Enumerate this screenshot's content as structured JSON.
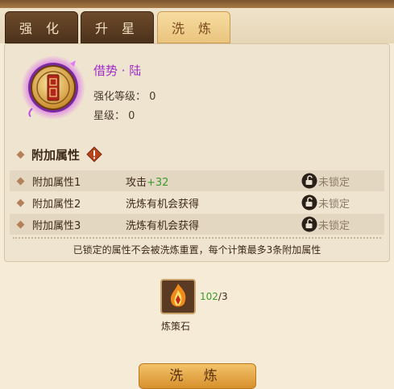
{
  "tabs": [
    {
      "label": "强 化",
      "active": false
    },
    {
      "label": "升 星",
      "active": false
    },
    {
      "label": "洗 炼",
      "active": true
    }
  ],
  "item": {
    "name": "借势 · 陆",
    "enhance_level": "强化等级：  0",
    "star_level": "星级：  0",
    "icon": "strategy-scroll-badge"
  },
  "attributes": {
    "title": "附加属性",
    "rows": [
      {
        "label": "附加属性1",
        "value_prefix": "攻击",
        "value_bonus": "+32",
        "lock_text": "未锁定"
      },
      {
        "label": "附加属性2",
        "value_prefix": "洗炼有机会获得",
        "value_bonus": "",
        "lock_text": "未锁定"
      },
      {
        "label": "附加属性3",
        "value_prefix": "洗炼有机会获得",
        "value_bonus": "",
        "lock_text": "未锁定"
      }
    ],
    "note": "已锁定的属性不会被洗炼重置，每个计策最多3条附加属性"
  },
  "material": {
    "name": "炼策石",
    "have": "102",
    "sep_need": "/3",
    "icon": "flame-crystal"
  },
  "action_button": {
    "label": "洗 炼"
  },
  "colors": {
    "accent_purple": "#a02bc6",
    "bonus_green": "#3c9a2c",
    "tab_active": "#e9c47e",
    "tab_inactive": "#4c321c"
  }
}
